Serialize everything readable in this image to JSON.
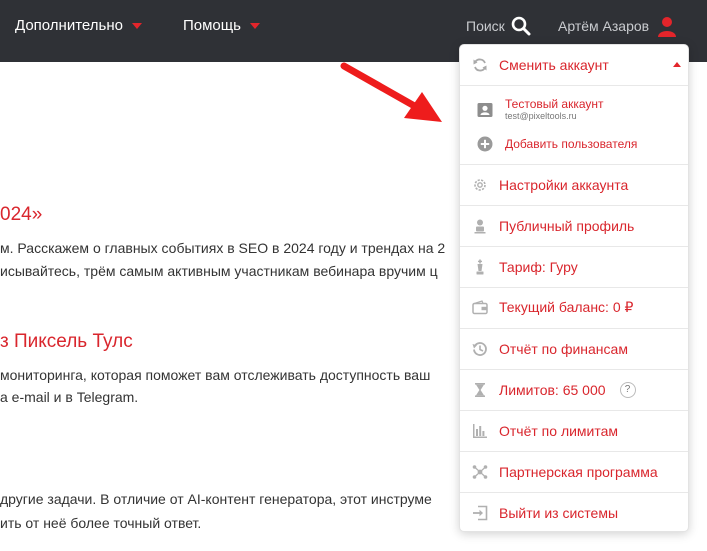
{
  "topbar": {
    "nav": [
      {
        "label": "Дополнительно"
      },
      {
        "label": "Помощь"
      }
    ],
    "search_label": "Поиск",
    "user_name": "Артём Азаров"
  },
  "article": {
    "heading1": "024»",
    "para1_line1": "м. Расскажем о главных событиях в SEO в 2024 году и трендах на 2",
    "para1_line2": "исывайтесь, трём самым активным участникам вебинара вручим ц",
    "heading2": "з Пиксель Тулс",
    "para2_line1": " мониторинга, которая поможет вам отслеживать доступность ваш",
    "para2_line2": "а e-mail и в Telegram.",
    "para3_line1": " другие задачи. В отличие от AI-контент генератора, этот инструме",
    "para3_line2": "ить от неё более точный ответ."
  },
  "dropdown": {
    "switch_account": "Сменить аккаунт",
    "accounts": [
      {
        "name": "Тестовый аккаунт",
        "email": "test@pixeltools.ru"
      }
    ],
    "add_user": "Добавить пользователя",
    "items": [
      {
        "label": "Настройки аккаунта",
        "icon": "gear-icon"
      },
      {
        "label": "Публичный профиль",
        "icon": "profile-icon"
      },
      {
        "label": "Тариф: Гуру",
        "icon": "chess-king-icon"
      },
      {
        "label": "Текущий баланс: 0 ₽",
        "icon": "wallet-icon"
      },
      {
        "label": "Отчёт по финансам",
        "icon": "history-icon"
      },
      {
        "label": "Лимитов: 65 000",
        "icon": "hourglass-icon",
        "badge": "?"
      },
      {
        "label": "Отчёт по лимитам",
        "icon": "bar-chart-icon"
      },
      {
        "label": "Партнерская программа",
        "icon": "network-icon"
      },
      {
        "label": "Выйти из системы",
        "icon": "logout-icon"
      }
    ]
  },
  "colors": {
    "accent": "#d9262d",
    "topbar": "#2f3136"
  }
}
